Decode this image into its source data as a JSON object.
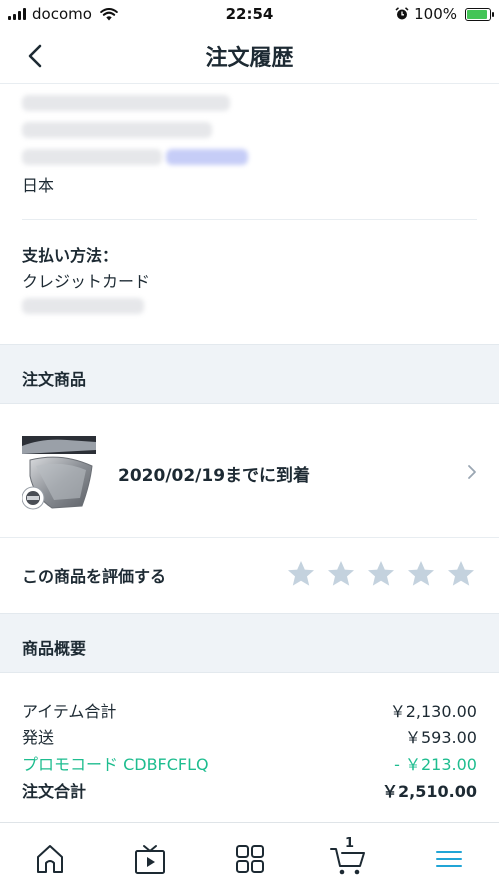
{
  "status_bar": {
    "carrier": "docomo",
    "time": "22:54",
    "battery": "100%"
  },
  "nav": {
    "title": "注文履歴"
  },
  "address": {
    "country": "日本"
  },
  "payment": {
    "label": "支払い方法：",
    "method": "クレジットカード"
  },
  "order_items": {
    "header": "注文商品",
    "item": {
      "delivery": "2020/02/19までに到着"
    }
  },
  "rating": {
    "label": "この商品を評価する",
    "max_stars": 5,
    "selected": 0
  },
  "summary": {
    "header": "商品概要",
    "rows": [
      {
        "label": "アイテム合計",
        "value": "￥2,130.00"
      },
      {
        "label": "発送",
        "value": "￥593.00"
      },
      {
        "label": "プロモコード CDBFCFLQ",
        "value": "- ￥213.00"
      },
      {
        "label": "注文合計",
        "value": "￥2,510.00"
      }
    ]
  },
  "tab_bar": {
    "cart_count": "1",
    "tabs": [
      "home-icon",
      "video-icon",
      "categories-icon",
      "cart-icon",
      "menu-icon"
    ]
  },
  "colors": {
    "accent": "#1ebd8f",
    "section_bg": "#eff3f7",
    "star": "#c4d2de",
    "menu_active": "#21a5d6"
  }
}
